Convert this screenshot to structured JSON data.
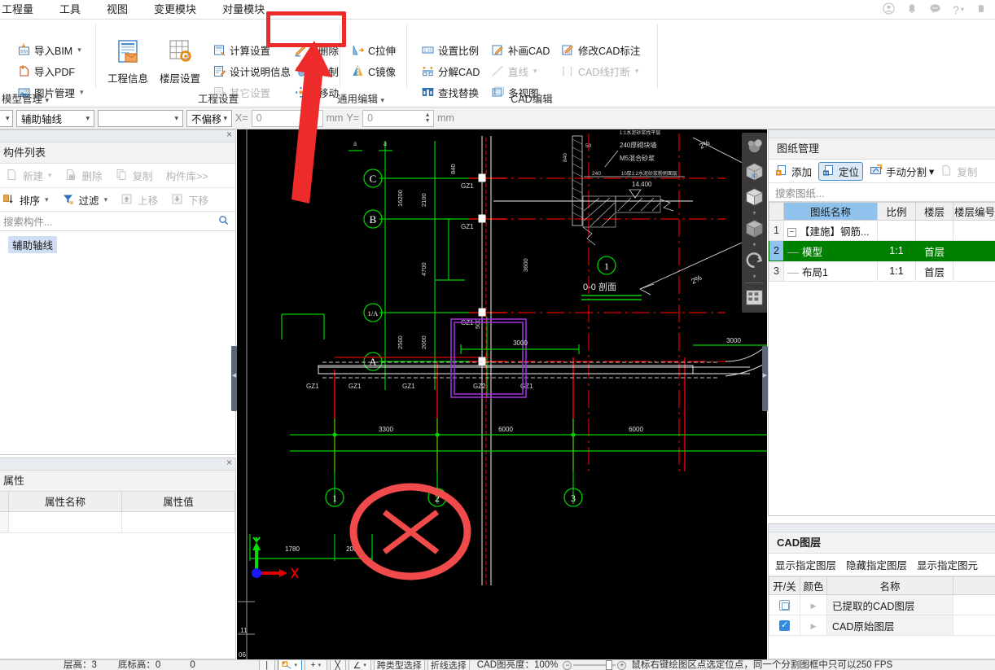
{
  "menubar": {
    "items": [
      "工程量",
      "工具",
      "视图",
      "变更模块",
      "对量模块"
    ],
    "window_icons": [
      "user-icon",
      "bell-icon",
      "chat-icon",
      "help-icon",
      "gift-icon"
    ],
    "help_label": "?"
  },
  "ribbon": {
    "groups": [
      {
        "name": "模型管理",
        "title": "模型管理",
        "buttons": [
          {
            "label": "导入BIM",
            "icon": "import-bim-icon",
            "dropdown": true,
            "disabled": false
          },
          {
            "label": "导入PDF",
            "icon": "import-pdf-icon",
            "dropdown": false,
            "disabled": false
          },
          {
            "label": "图片管理",
            "icon": "image-manage-icon",
            "dropdown": true,
            "disabled": false
          }
        ]
      },
      {
        "name": "工程设置",
        "title": "工程设置",
        "big_buttons": [
          {
            "label": "工程信息",
            "icon": "project-info-icon"
          },
          {
            "label": "楼层设置",
            "icon": "floor-settings-icon"
          }
        ],
        "buttons": [
          {
            "label": "计算设置",
            "icon": "calc-settings-icon",
            "disabled": false
          },
          {
            "label": "设计说明信息",
            "icon": "design-note-icon",
            "disabled": false
          },
          {
            "label": "其它设置",
            "icon": "other-settings-icon",
            "disabled": true
          }
        ]
      },
      {
        "name": "通用编辑",
        "title": "通用编辑",
        "buttons": [
          {
            "label": "C删除",
            "icon": "c-delete-icon",
            "highlighted": true
          },
          {
            "label": "C拉伸",
            "icon": "c-stretch-icon"
          },
          {
            "label": "C复制",
            "icon": "c-copy-icon"
          },
          {
            "label": "C镜像",
            "icon": "c-mirror-icon"
          },
          {
            "label": "C移动",
            "icon": "c-move-icon"
          }
        ]
      },
      {
        "name": "CAD编辑",
        "title": "CAD编辑",
        "buttons": [
          {
            "label": "设置比例",
            "icon": "set-scale-icon",
            "disabled": false
          },
          {
            "label": "补画CAD",
            "icon": "redraw-cad-icon",
            "disabled": false
          },
          {
            "label": "修改CAD标注",
            "icon": "edit-cad-dim-icon",
            "disabled": false
          },
          {
            "label": "分解CAD",
            "icon": "explode-cad-icon",
            "disabled": false
          },
          {
            "label": "直线",
            "icon": "line-icon",
            "disabled": true,
            "dropdown": true
          },
          {
            "label": "CAD线打断",
            "icon": "break-cad-line-icon",
            "disabled": true,
            "dropdown": true
          },
          {
            "label": "查找替换",
            "icon": "find-replace-icon",
            "disabled": false
          },
          {
            "label": "多视图",
            "icon": "multi-view-icon",
            "disabled": false
          }
        ]
      }
    ]
  },
  "attrbar": {
    "combo1_value": "",
    "combo2_value": "辅助轴线",
    "combo3_value": "",
    "combo4_value": "不偏移",
    "x_label": "X=",
    "x_value": "0",
    "x_unit": "mm",
    "y_label": "Y=",
    "y_value": "0",
    "y_unit": "mm"
  },
  "left_panel": {
    "title": "构件列表",
    "close_label": "×",
    "tools_row1": [
      {
        "label": "新建",
        "icon": "new-icon",
        "dropdown": true,
        "disabled": true
      },
      {
        "label": "删除",
        "icon": "delete-icon",
        "disabled": true
      },
      {
        "label": "复制",
        "icon": "copy-icon",
        "disabled": true
      },
      {
        "label": "构件库>>",
        "icon": "component-library-icon",
        "disabled": true
      }
    ],
    "tools_row2": [
      {
        "label": "排序",
        "icon": "sort-icon",
        "dropdown": true,
        "disabled": false
      },
      {
        "label": "过滤",
        "icon": "filter-icon",
        "dropdown": true,
        "disabled": false
      },
      {
        "label": "上移",
        "icon": "move-up-icon",
        "disabled": true
      },
      {
        "label": "下移",
        "icon": "move-down-icon",
        "disabled": true
      }
    ],
    "search_placeholder": "搜索构件...",
    "search_icon": "search-icon",
    "tree_items": [
      "辅助轴线"
    ]
  },
  "props_panel": {
    "title": "属性",
    "close_label": "×",
    "columns": [
      "属性名称",
      "属性值"
    ],
    "rows": [
      [
        "",
        ""
      ]
    ]
  },
  "drawings_panel": {
    "title": "图纸管理",
    "tools": [
      {
        "label": "添加",
        "icon": "add-drawing-icon",
        "state": "normal"
      },
      {
        "label": "定位",
        "icon": "locate-icon",
        "state": "selected"
      },
      {
        "label": "手动分割",
        "icon": "manual-split-icon",
        "state": "normal",
        "dropdown": true
      },
      {
        "label": "复制",
        "icon": "copy-drawing-icon",
        "state": "disabled"
      }
    ],
    "search_placeholder": "搜索图纸...",
    "columns": [
      "",
      "图纸名称",
      "比例",
      "楼层",
      "楼层编号"
    ],
    "rows": [
      {
        "index": "1",
        "name": "【建施】钢筋...",
        "scale": "",
        "floor": "",
        "floor_no": "",
        "selected": false,
        "node": "parent"
      },
      {
        "index": "2",
        "name": "模型",
        "scale": "1:1",
        "floor": "首层",
        "floor_no": "",
        "selected": true,
        "node": "child"
      },
      {
        "index": "3",
        "name": "布局1",
        "scale": "1:1",
        "floor": "首层",
        "floor_no": "",
        "selected": false,
        "node": "child"
      }
    ]
  },
  "layers_panel": {
    "title": "CAD图层",
    "links": [
      "显示指定图层",
      "隐藏指定图层",
      "显示指定图元"
    ],
    "columns": [
      "开/关",
      "颜色",
      "名称"
    ],
    "rows": [
      {
        "on": false,
        "color_icon": "triangle-icon",
        "name": "已提取的CAD图层"
      },
      {
        "on": true,
        "color_icon": "triangle-icon",
        "name": "CAD原始图层"
      }
    ]
  },
  "statusbar": {
    "floor_height_label": "层高：3",
    "base_elevation_label": "底标高：0",
    "extra_value": "0",
    "buttons": [
      {
        "label": "|",
        "name": "ortho-toggle",
        "selected": false
      },
      {
        "label": "",
        "name": "snap-mode-button",
        "selected": true,
        "dropdown": true
      },
      {
        "label": "+",
        "name": "crosshair-button",
        "selected": false,
        "dropdown": true
      },
      {
        "label": "╳",
        "name": "intersection-snap-button",
        "selected": false
      },
      {
        "label": "∠",
        "name": "angle-snap-button",
        "selected": false,
        "dropdown": true
      },
      {
        "label": "跨类型选择",
        "name": "cross-type-select-button",
        "selected": false
      },
      {
        "label": "折线选择",
        "name": "polyline-select-button",
        "selected": false
      }
    ],
    "cad_brightness_label": "CAD图亮度：100%",
    "zoom_minus": "−",
    "zoom_plus": "+",
    "hint": "鼠标右键绘图区点选定位点，同一个分割图框中只可以250 FPS"
  },
  "viewport": {
    "background": "#000000",
    "axis": {
      "x_label": "X",
      "y_label": "Y",
      "x_color": "#ff0000",
      "y_color": "#00ff00"
    },
    "nav_buttons": [
      "orbit-icon",
      "view-3d-icon",
      "view-cube-icon",
      "view-solid-icon",
      "rotate-icon",
      "layers-grid-icon"
    ],
    "grid_labels_vertical": [
      "C",
      "B",
      "1/A",
      "A"
    ],
    "grid_labels_horizontal": [
      "1",
      "2",
      "3"
    ],
    "dimensions_horizontal": [
      "3300",
      "6000",
      "6000"
    ],
    "dimensions_small": [
      "1780",
      "2000",
      "3000",
      "3000"
    ],
    "dimensions_vertical": [
      "16200",
      "2100",
      "4700",
      "500",
      "2500",
      "2000",
      "3600"
    ],
    "beam_labels": [
      "GZ1",
      "GZ1",
      "GZ1",
      "GZ1",
      "GZ1",
      "GZ1",
      "GZ2",
      "GZ1"
    ],
    "section_label": "0-0 剖面",
    "detail_notes": [
      "240厚砌块墙",
      "M5混合砂浆",
      "50",
      "240",
      "840",
      "14.400",
      "2%",
      "2%",
      "a",
      "a"
    ]
  },
  "annotations": {
    "rect_color": "#ec2b2b",
    "arrow_color": "#ee2b2b",
    "circle_color": "#f04a4a"
  }
}
